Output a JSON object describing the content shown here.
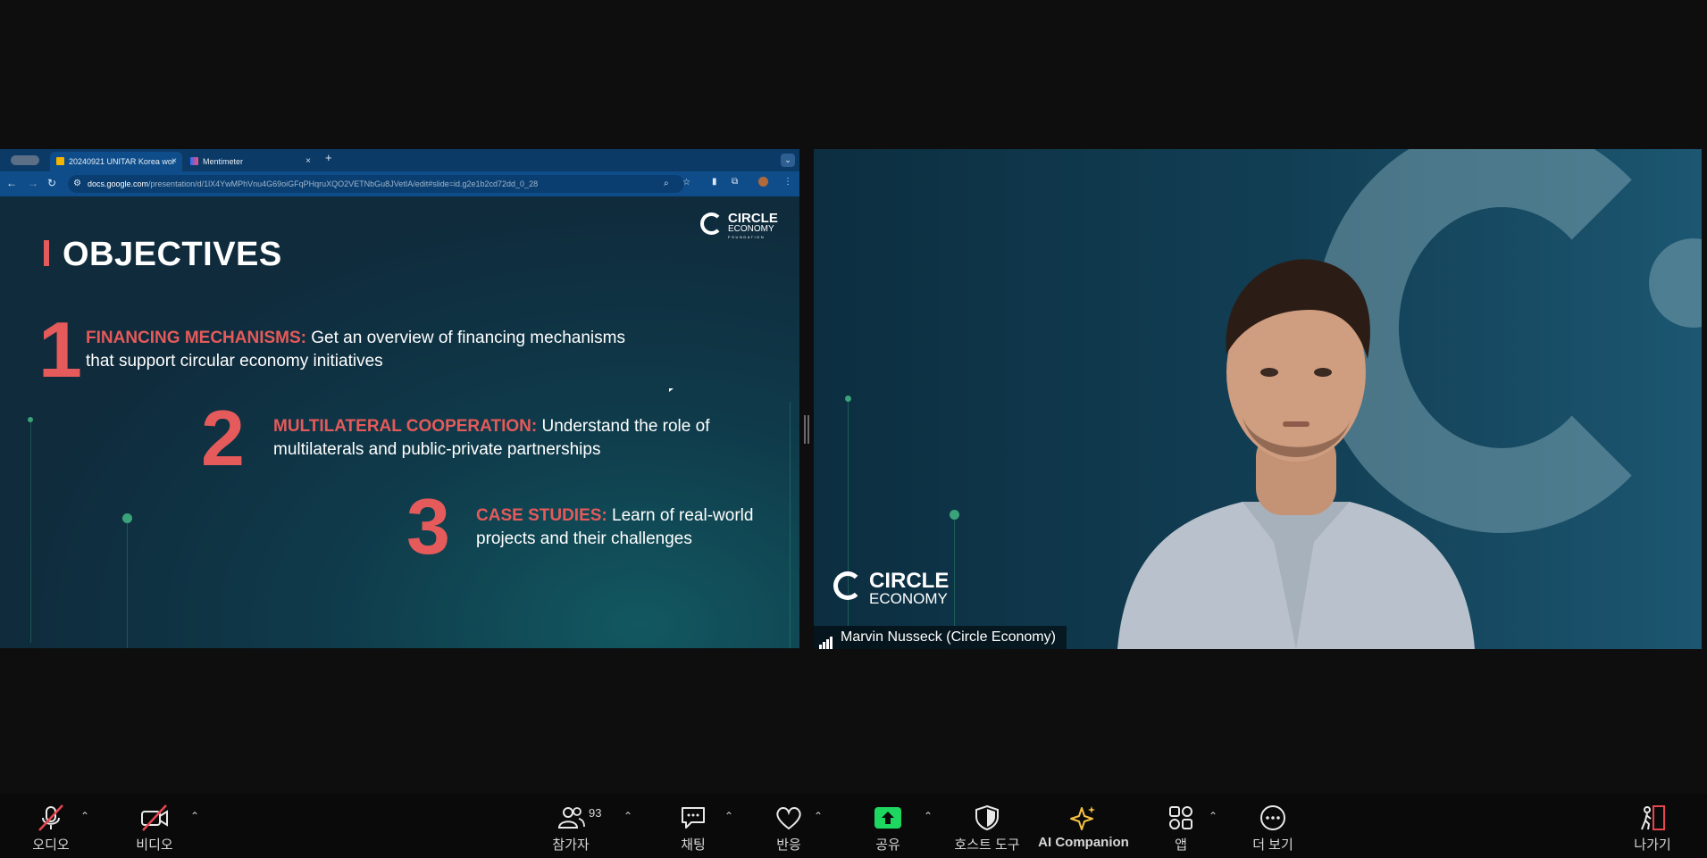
{
  "browser": {
    "tabs": [
      {
        "label": "20240921 UNITAR Korea wor",
        "close": "×"
      },
      {
        "label": "Mentimeter",
        "close": "×"
      }
    ],
    "new_tab": "+",
    "url_host": "docs.google.com",
    "url_path": "/presentation/d/1lX4YwMPhVnu4G69oiGFqPHqruXQO2VETNbGu8JVetIA/edit#slide=id.g2e1b2cd72dd_0_28"
  },
  "slide": {
    "title": "OBJECTIVES",
    "logo_line1": "CIRCLE",
    "logo_line2": "ECONOMY",
    "logo_line3": "FOUNDATION",
    "objectives": [
      {
        "number": "1",
        "heading": "FINANCING MECHANISMS:",
        "text_line1": " Get an overview of financing mechanisms",
        "text_line2": "that support circular economy initiatives"
      },
      {
        "number": "2",
        "heading": "MULTILATERAL COOPERATION:",
        "text_line1": " Understand the role of",
        "text_line2": "multilaterals and public-private partnerships"
      },
      {
        "number": "3",
        "heading": "CASE STUDIES:",
        "text_line1": " Learn of real-world",
        "text_line2": "projects and their challenges"
      }
    ]
  },
  "video": {
    "participant_name": "Marvin Nusseck (Circle Economy)",
    "logo_line1": "CIRCLE",
    "logo_line2": "ECONOMY"
  },
  "toolbar": {
    "audio": "오디오",
    "video": "비디오",
    "participants": "참가자",
    "participants_count": "93",
    "chat": "채팅",
    "reactions": "반응",
    "share": "공유",
    "host_tools": "호스트 도구",
    "ai_companion": "AI Companion",
    "apps": "앱",
    "more": "더 보기",
    "leave": "나가기"
  },
  "colors": {
    "accent_red": "#e55a5a",
    "share_green": "#1ed760",
    "ai_yellow": "#f5c242",
    "leave_red": "#e8464f"
  }
}
